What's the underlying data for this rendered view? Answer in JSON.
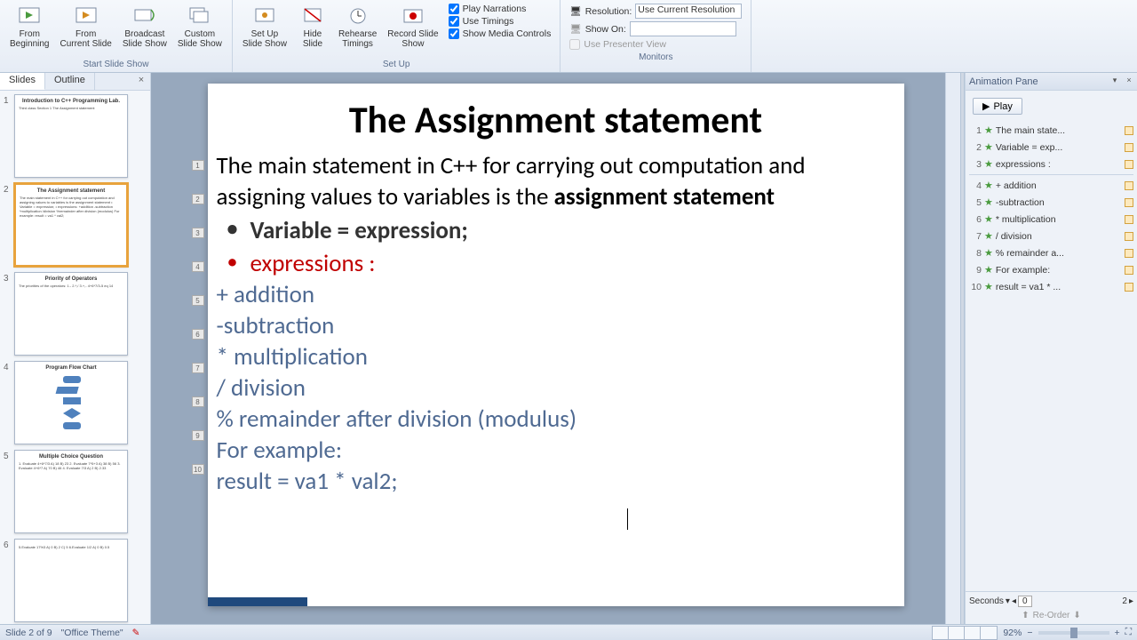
{
  "ribbon": {
    "groups": {
      "start": {
        "label": "Start Slide Show",
        "from_beginning": "From\nBeginning",
        "from_current": "From\nCurrent Slide",
        "broadcast": "Broadcast\nSlide Show",
        "custom": "Custom\nSlide Show"
      },
      "setup": {
        "label": "Set Up",
        "setup_show": "Set Up\nSlide Show",
        "hide_slide": "Hide\nSlide",
        "rehearse": "Rehearse\nTimings",
        "record": "Record Slide\nShow",
        "play_narrations": "Play Narrations",
        "use_timings": "Use Timings",
        "show_media": "Show Media Controls"
      },
      "monitors": {
        "label": "Monitors",
        "resolution_label": "Resolution:",
        "resolution_value": "Use Current Resolution",
        "show_on_label": "Show On:",
        "presenter_view": "Use Presenter View"
      }
    }
  },
  "slides_panel": {
    "tab_slides": "Slides",
    "tab_outline": "Outline",
    "thumbs": [
      {
        "num": "1",
        "title": "Introduction to C++\nProgramming Lab.",
        "body": "Third class Section 1\nThe Assignment statement"
      },
      {
        "num": "2",
        "title": "The Assignment statement",
        "body": "The main statement in C++ for carrying out computation and assigning values to variables is the assignment statement\n• Variable = expression;\n• expressions:\n+addition\n-subtraction\n*multiplication\n/division\n%remainder after division (modulus)\nFor example:\nresult = va1 * val2;"
      },
      {
        "num": "3",
        "title": "Priority of Operators",
        "body": "The priorities of the operators:\n1.-\n2.*,/\n3.+,-\n\n4+6*7/3-5 eq 14"
      },
      {
        "num": "4",
        "title": "Program Flow Chart",
        "body": ""
      },
      {
        "num": "5",
        "title": "Multiple Choice Question",
        "body": "1. Evaluate 4+6*7/3\nA) 18\nB) 23\n2. Evaluate 7*5+3\nA) 38\nB) 56\n3. Evaluate 4+6*7\nA) 70\nB) 46\n4. Evaluate 7/3\nA) 2\nB) 2.33"
      },
      {
        "num": "6",
        "title": "",
        "body": "5.Evaluate 17%3\nA) 0\nB) 2\nC) 5\n6.Evaluate 1/2\nA) 0\nB) 0.5"
      }
    ]
  },
  "slide": {
    "title": "The Assignment statement",
    "p1_a": "The main statement in C++ for carrying out computation and assigning values to variables is the ",
    "p1_b": "assignment statement",
    "bullet1": "Variable = expression;",
    "bullet2": "expressions :",
    "op1": "+ addition",
    "op2": "-subtraction",
    "op3": "* multiplication",
    "op4": "/ division",
    "op5": "% remainder after division (modulus)",
    "ex1": "For example:",
    "ex2": "result = va1 * val2;",
    "markers": [
      "1",
      "2",
      "3",
      "4",
      "5",
      "6",
      "7",
      "8",
      "9",
      "10"
    ]
  },
  "anim_pane": {
    "title": "Animation Pane",
    "play": "Play",
    "items": [
      {
        "n": "1",
        "label": "The main state..."
      },
      {
        "n": "2",
        "label": "Variable = exp..."
      },
      {
        "n": "3",
        "label": "expressions :"
      },
      {
        "n": "4",
        "label": "+ addition"
      },
      {
        "n": "5",
        "label": "-subtraction"
      },
      {
        "n": "6",
        "label": "* multiplication"
      },
      {
        "n": "7",
        "label": "/ division"
      },
      {
        "n": "8",
        "label": "% remainder a..."
      },
      {
        "n": "9",
        "label": "For example:"
      },
      {
        "n": "10",
        "label": "result = va1 * ..."
      }
    ],
    "seconds_label": "Seconds",
    "tl_start": "0",
    "tl_end": "2",
    "reorder": "Re-Order"
  },
  "status": {
    "slide_info": "Slide 2 of 9",
    "theme": "\"Office Theme\"",
    "zoom": "92%"
  }
}
